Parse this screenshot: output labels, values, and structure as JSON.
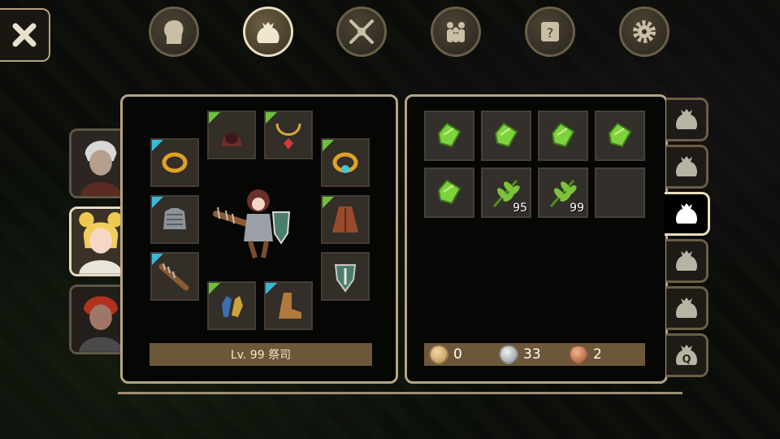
{
  "header": {
    "top_tabs": [
      {
        "name": "character-tab",
        "icon": "head-silhouette-icon"
      },
      {
        "name": "inventory-tab",
        "icon": "bag-icon",
        "active": true
      },
      {
        "name": "skills-tab",
        "icon": "crossed-weapons-icon"
      },
      {
        "name": "party-tab",
        "icon": "people-icon"
      },
      {
        "name": "quest-tab",
        "icon": "scroll-question-icon"
      },
      {
        "name": "settings-tab",
        "icon": "gear-icon"
      }
    ]
  },
  "party": [
    {
      "name": "white-haired-hero",
      "active": false
    },
    {
      "name": "blonde-priestess",
      "active": true
    },
    {
      "name": "red-haired-knight",
      "active": false
    }
  ],
  "equipment": {
    "level_label": "Lv. 99 祭司",
    "slots": [
      {
        "name": "helmet",
        "icon": "hood-icon",
        "rarity": "green"
      },
      {
        "name": "necklace",
        "icon": "ruby-necklace-icon",
        "rarity": "green"
      },
      {
        "name": "ring-left",
        "icon": "gold-ring-icon",
        "rarity": "blue"
      },
      {
        "name": "ring-right",
        "icon": "aquamarine-ring-icon",
        "rarity": "green"
      },
      {
        "name": "armor",
        "icon": "chainmail-icon",
        "rarity": "blue"
      },
      {
        "name": "cloak",
        "icon": "leather-cloak-icon",
        "rarity": "green"
      },
      {
        "name": "weapon",
        "icon": "spiked-club-icon",
        "rarity": "blue"
      },
      {
        "name": "shield",
        "icon": "kite-shield-icon",
        "rarity": "none"
      },
      {
        "name": "gloves",
        "icon": "gauntlets-icon",
        "rarity": "green"
      },
      {
        "name": "boots",
        "icon": "leather-boots-icon",
        "rarity": "blue"
      }
    ]
  },
  "inventory": {
    "items": [
      {
        "icon": "green-gem-icon",
        "qty": ""
      },
      {
        "icon": "green-gem-icon",
        "qty": ""
      },
      {
        "icon": "green-gem-icon",
        "qty": ""
      },
      {
        "icon": "green-gem-icon",
        "qty": ""
      },
      {
        "icon": "green-gem-icon",
        "qty": ""
      },
      {
        "icon": "herb-leaf-icon",
        "qty": "95"
      },
      {
        "icon": "herb-leaf-icon",
        "qty": "99"
      },
      {
        "icon": "",
        "qty": ""
      }
    ],
    "currency": {
      "gold": "0",
      "silver": "33",
      "copper": "2"
    }
  },
  "bag_tabs": [
    {
      "name": "bag-1",
      "active": false
    },
    {
      "name": "bag-2",
      "active": false
    },
    {
      "name": "bag-3",
      "active": true
    },
    {
      "name": "bag-4",
      "active": false
    },
    {
      "name": "bag-5",
      "active": false
    },
    {
      "name": "quest-bag",
      "active": false,
      "label": "Q"
    }
  ],
  "colors": {
    "panel_border": "#b4a584",
    "level_bar": "#6c5838",
    "rarity_blue": "#3bb7d8",
    "rarity_green": "#6cc03c"
  }
}
